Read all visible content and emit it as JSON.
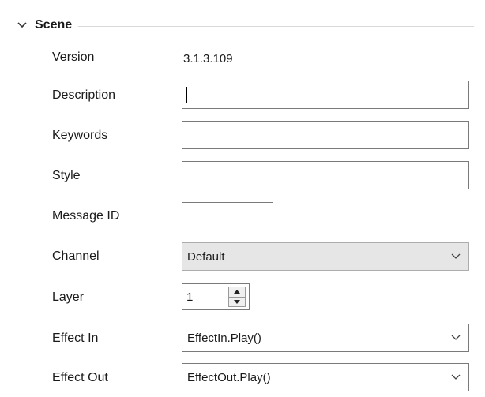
{
  "section": {
    "title": "Scene",
    "chevron_icon": "chevron-down-icon"
  },
  "fields": {
    "version": {
      "label": "Version",
      "value": "3.1.3.109"
    },
    "description": {
      "label": "Description",
      "value": ""
    },
    "keywords": {
      "label": "Keywords",
      "value": ""
    },
    "style": {
      "label": "Style",
      "value": ""
    },
    "message_id": {
      "label": "Message ID",
      "value": ""
    },
    "channel": {
      "label": "Channel",
      "value": "Default"
    },
    "layer": {
      "label": "Layer",
      "value": "1"
    },
    "effect_in": {
      "label": "Effect In",
      "value": "EffectIn.Play()"
    },
    "effect_out": {
      "label": "Effect Out",
      "value": "EffectOut.Play()"
    }
  }
}
